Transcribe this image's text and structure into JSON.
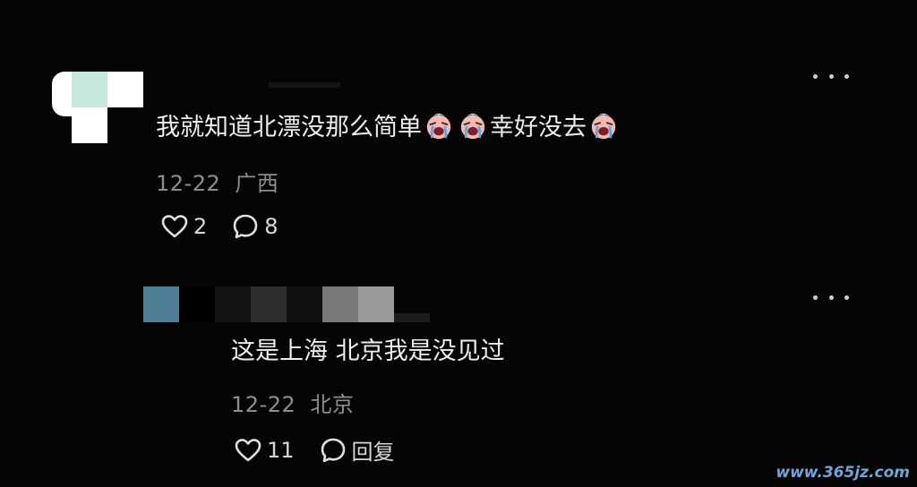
{
  "comments": [
    {
      "text_before": "我就知道北漂没那么简单",
      "text_after": "幸好没去",
      "emoji_name": "crying-face-emoji",
      "date": "12-22",
      "location": "广西",
      "likes": "2",
      "replies": "8"
    },
    {
      "text": "这是上海 北京我是没见过",
      "date": "12-22",
      "location": "北京",
      "likes": "11",
      "reply_label": "回复"
    }
  ],
  "watermark": "www.365jz.com",
  "colors": {
    "background": "#050505",
    "text": "#eeeeee",
    "meta": "#8e8e8e"
  }
}
